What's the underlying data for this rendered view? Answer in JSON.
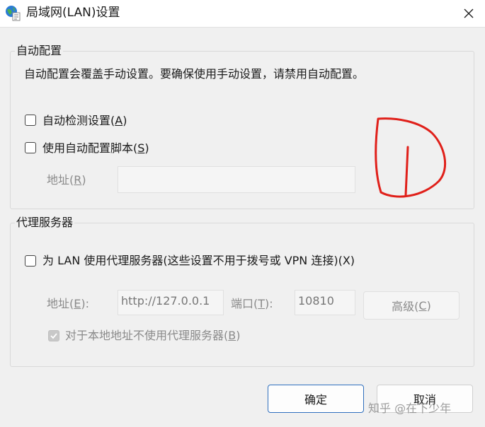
{
  "window": {
    "title": "局域网(LAN)设置",
    "icon": "globe-settings-icon",
    "close_icon": "close-icon"
  },
  "auto_config": {
    "group_label": "自动配置",
    "description": "自动配置会覆盖手动设置。要确保使用手动设置，请禁用自动配置。",
    "auto_detect": {
      "label_pre": "自动检测设置(",
      "mnemonic": "A",
      "label_post": ")",
      "checked": false
    },
    "use_script": {
      "label_pre": "使用自动配置脚本(",
      "mnemonic": "S",
      "label_post": ")",
      "checked": false
    },
    "address": {
      "label_pre": "地址(",
      "mnemonic": "R",
      "label_post": ")",
      "value": ""
    }
  },
  "proxy": {
    "group_label": "代理服务器",
    "use_proxy": {
      "label": "为 LAN 使用代理服务器(这些设置不用于拨号或 VPN 连接)(X)",
      "checked": false
    },
    "address": {
      "label_pre": "地址(",
      "mnemonic": "E",
      "label_post": "):",
      "value": "http://127.0.0.1"
    },
    "port": {
      "label_pre": "端口(",
      "mnemonic": "T",
      "label_post": "):",
      "value": "10810"
    },
    "advanced": {
      "label_pre": "高级(",
      "mnemonic": "C",
      "label_post": ")"
    },
    "bypass_local": {
      "label_pre": "对于本地地址不使用代理服务器(",
      "mnemonic": "B",
      "label_post": ")",
      "checked": true
    }
  },
  "footer": {
    "ok_label": "确定",
    "cancel_label": "取消"
  },
  "watermark": "知乎 @在下少年",
  "colors": {
    "primary_border": "#2f6fbe",
    "annotation": "#e0201a"
  }
}
